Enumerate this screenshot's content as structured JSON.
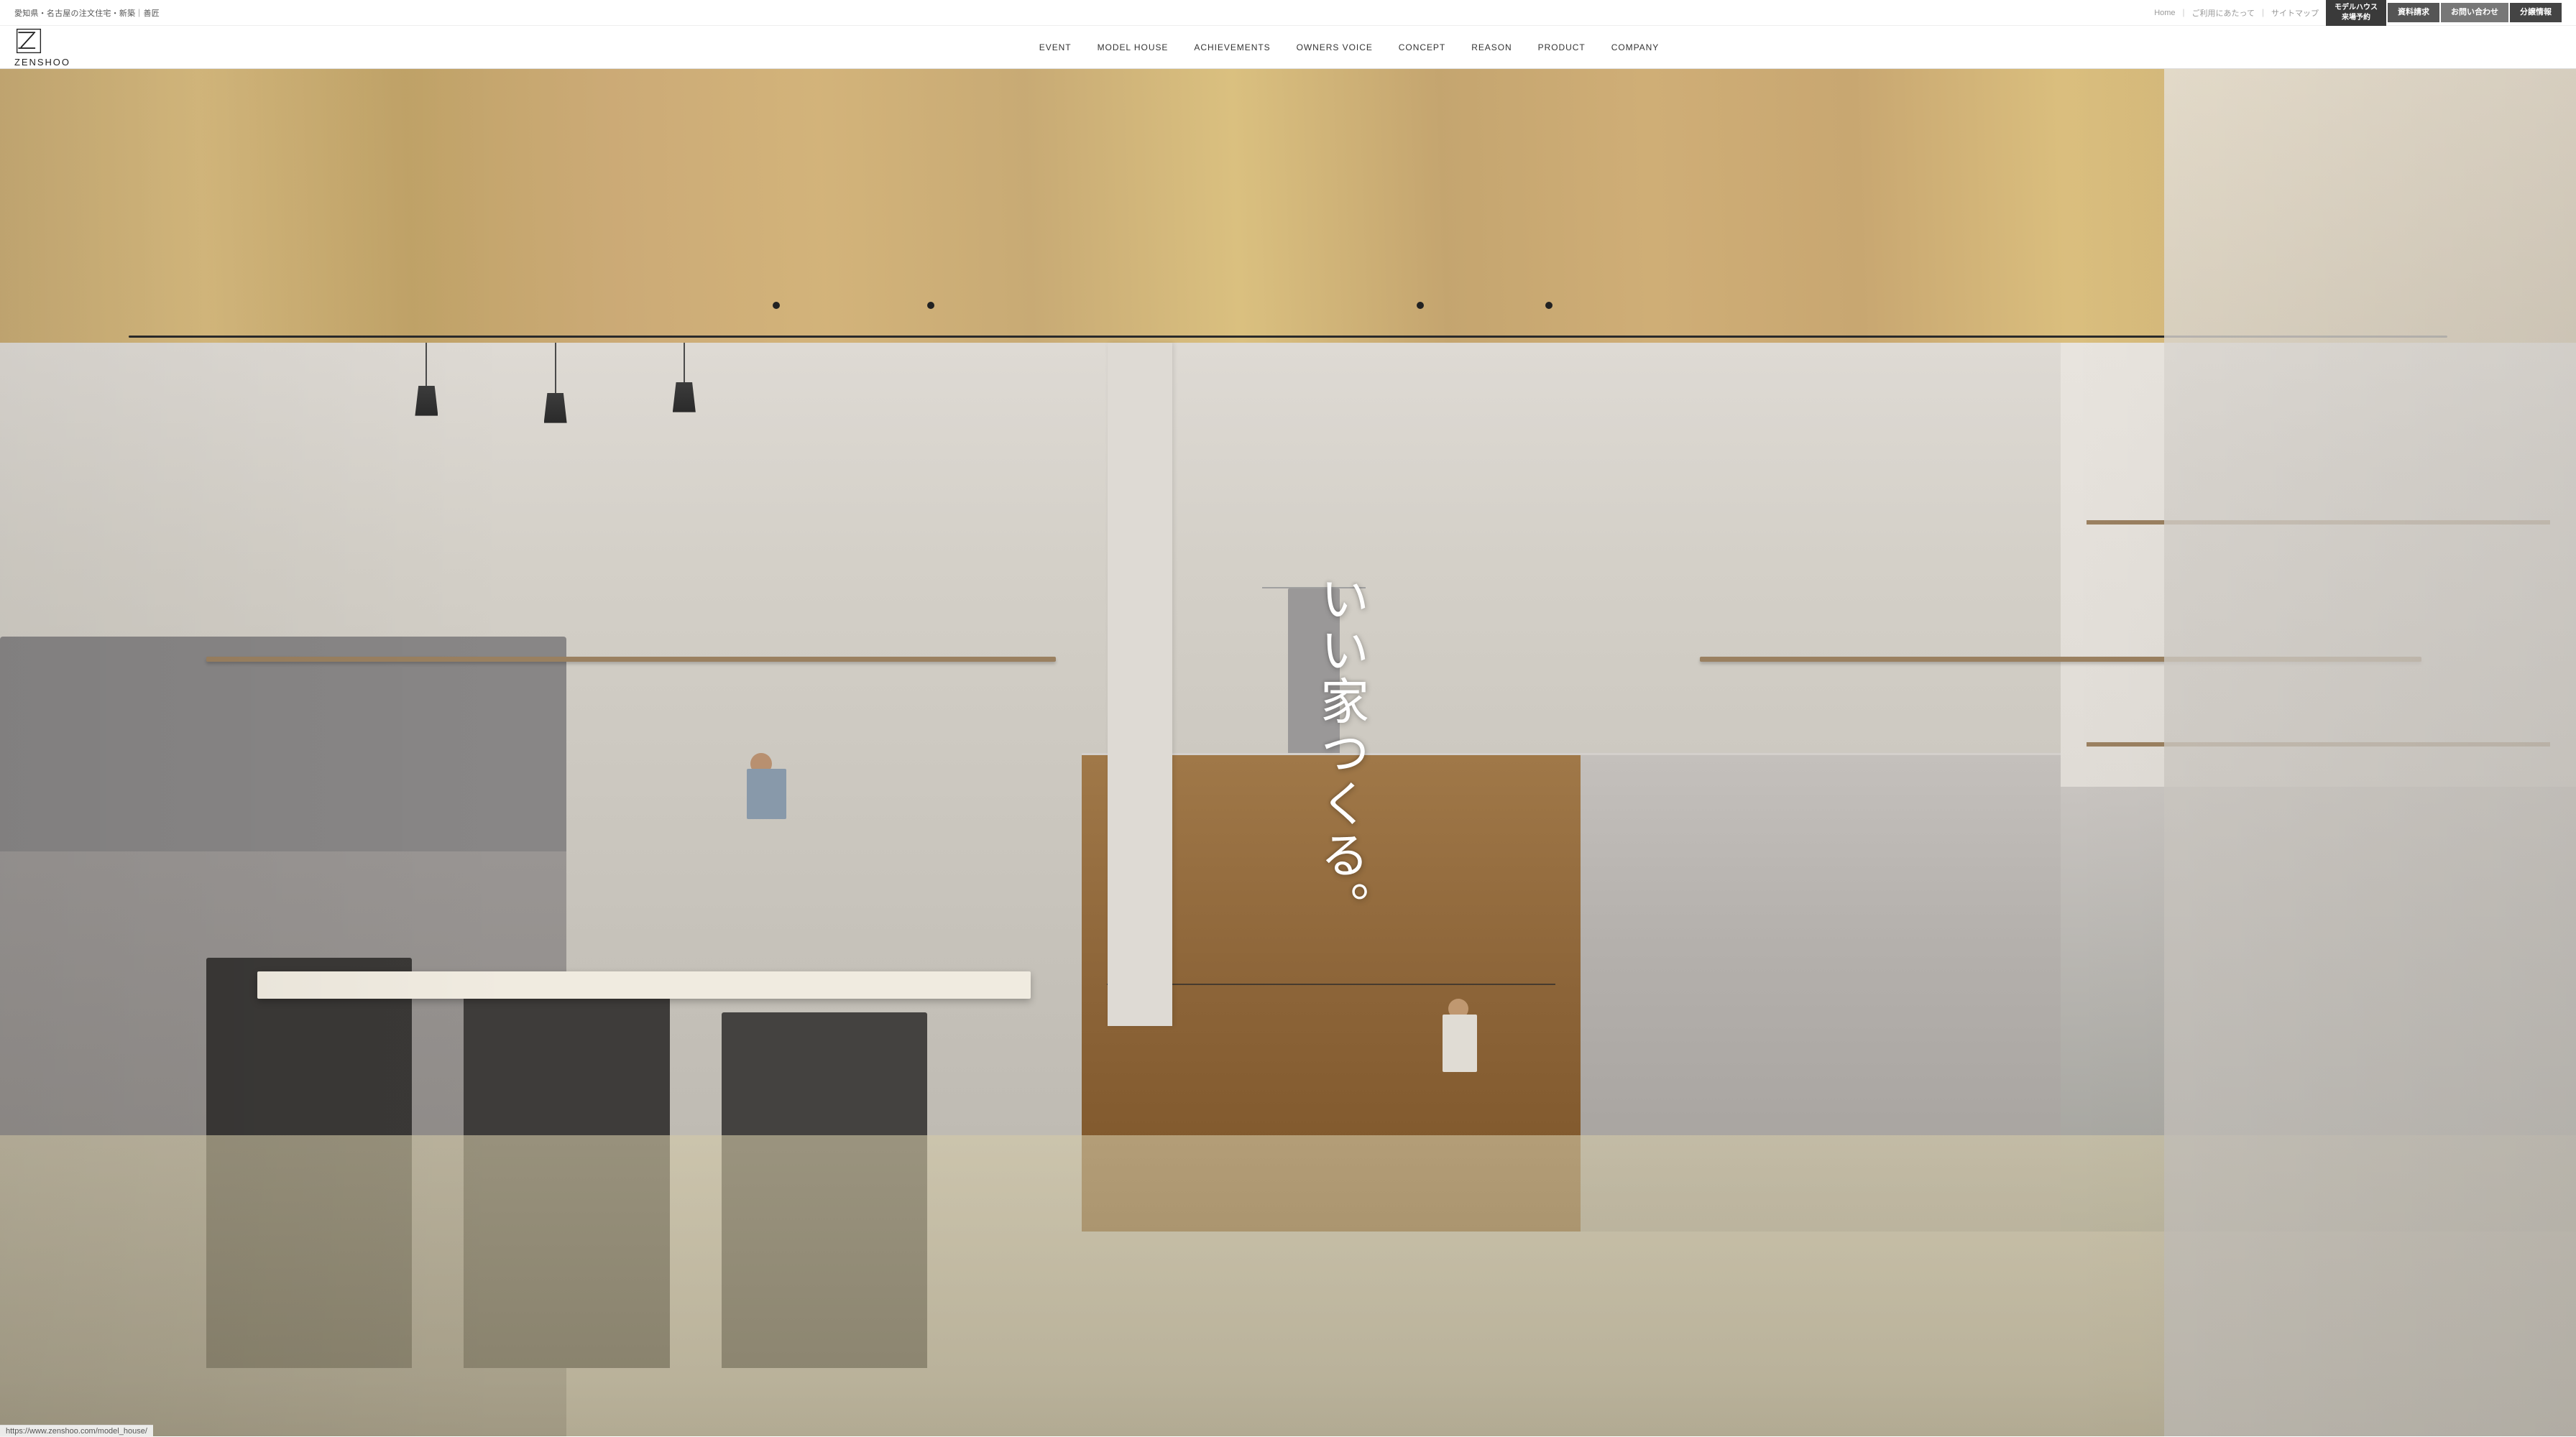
{
  "header": {
    "tagline": "愛知県・名古屋の注文住宅・新築｜善匠",
    "top_links": {
      "home": "Home",
      "separator1": "｜",
      "terms": "ご利用にあたって",
      "separator2": "｜",
      "sitemap": "サイトマップ"
    },
    "cta_buttons": [
      {
        "id": "model-house-visit",
        "line1": "モデルハウス",
        "line2": "来場予約"
      },
      {
        "id": "brochure",
        "label": "資料請求"
      },
      {
        "id": "contact",
        "label": "お問い合わせ"
      },
      {
        "id": "info",
        "label": "分譲情報"
      }
    ],
    "logo": {
      "text": "ZENSHOO"
    },
    "nav_items": [
      {
        "id": "event",
        "label": "EVENT"
      },
      {
        "id": "model-house",
        "label": "MODEL HOUSE"
      },
      {
        "id": "achievements",
        "label": "ACHIEVEMENTS"
      },
      {
        "id": "owners-voice",
        "label": "OWNERS VOICE"
      },
      {
        "id": "concept",
        "label": "CONCEPT"
      },
      {
        "id": "reason",
        "label": "REASON"
      },
      {
        "id": "product",
        "label": "PRODUCT"
      },
      {
        "id": "company",
        "label": "COMPANY"
      }
    ]
  },
  "hero": {
    "tagline": "いい家つくる。",
    "tagline_chars": [
      "い",
      "い",
      "家",
      "つ",
      "く",
      "る",
      "。"
    ]
  },
  "url_bar": {
    "url": "https://www.zenshoo.com/model_house/"
  }
}
